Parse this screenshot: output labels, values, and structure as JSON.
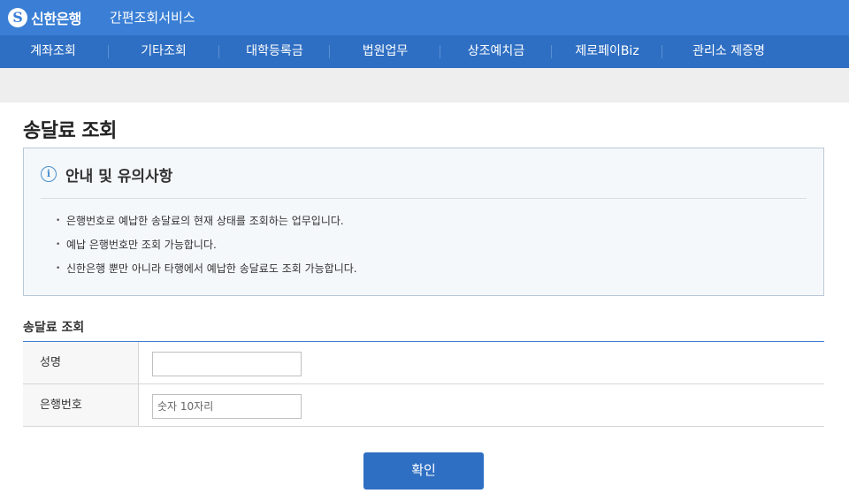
{
  "header": {
    "logo_mark": "S",
    "logo_text": "신한은행",
    "service_title": "간편조회서비스"
  },
  "nav": {
    "items": [
      {
        "label": "계좌조회"
      },
      {
        "label": "기타조회"
      },
      {
        "label": "대학등록금"
      },
      {
        "label": "법원업무"
      },
      {
        "label": "상조예치금"
      },
      {
        "label": "제로페이Biz"
      },
      {
        "label": "관리소 제증명"
      }
    ]
  },
  "page": {
    "title": "송달료 조회"
  },
  "notice": {
    "icon": "info-icon",
    "title": "안내 및 유의사항",
    "bullets": [
      "은행번호로 예납한 송달료의 현재 상태를 조회하는 업무입니다.",
      "예납 은행번호만 조회 가능합니다.",
      "신한은행 뿐만 아니라 타행에서 예납한 송달료도 조회 가능합니다."
    ]
  },
  "form": {
    "section_title": "송달료 조회",
    "name_label": "성명",
    "name_value": "",
    "name_placeholder": "",
    "bank_number_label": "은행번호",
    "bank_number_value": "",
    "bank_number_placeholder": "숫자 10자리"
  },
  "actions": {
    "confirm_label": "확인"
  },
  "colors": {
    "topbar": "#3a7fd5",
    "nav": "#2f6fc3",
    "button": "#2f6fc3"
  }
}
